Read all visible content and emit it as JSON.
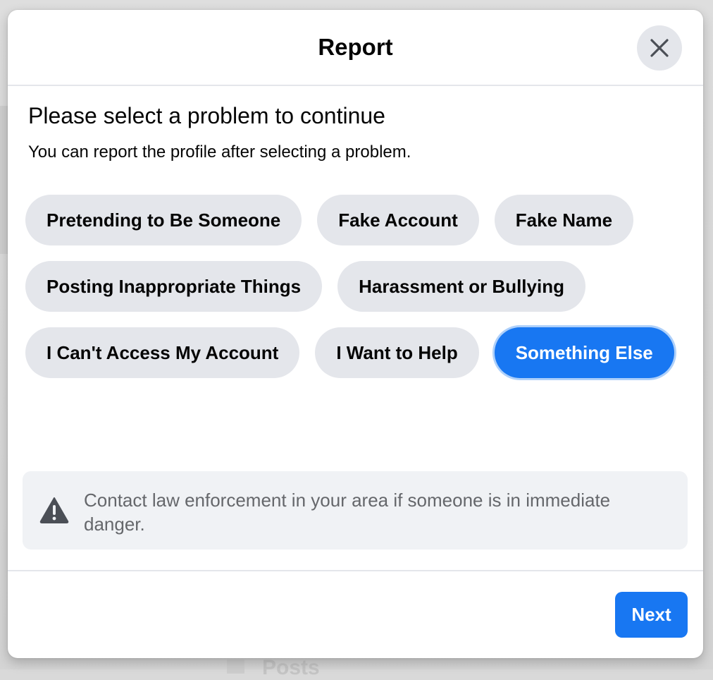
{
  "dialog": {
    "title": "Report",
    "close_icon": "close-icon",
    "heading": "Please select a problem to continue",
    "subheading": "You can report the profile after selecting a problem.",
    "options": [
      {
        "label": "Pretending to Be Someone",
        "selected": false
      },
      {
        "label": "Fake Account",
        "selected": false
      },
      {
        "label": "Fake Name",
        "selected": false
      },
      {
        "label": "Posting Inappropriate Things",
        "selected": false
      },
      {
        "label": "Harassment or Bullying",
        "selected": false
      },
      {
        "label": "I Can't Access My Account",
        "selected": false
      },
      {
        "label": "I Want to Help",
        "selected": false
      },
      {
        "label": "Something Else",
        "selected": true
      }
    ],
    "notice": {
      "icon": "warning-icon",
      "text": "Contact law enforcement in your area if someone is in immediate danger."
    },
    "next_label": "Next"
  },
  "background": {
    "partial_text": "Posts"
  },
  "colors": {
    "accent": "#1877f2",
    "chip_bg": "#e4e6eb",
    "notice_bg": "#f0f2f5",
    "secondary_text": "#65676b"
  }
}
